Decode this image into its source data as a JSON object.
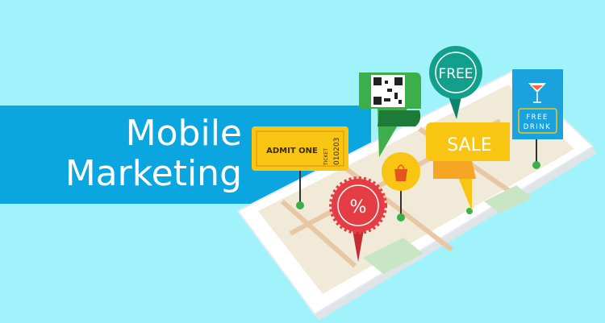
{
  "headline": {
    "line1": "Mobile",
    "line2": "Marketing"
  },
  "tags": {
    "ticket": {
      "main": "ADMIT ONE",
      "side_label": "TICKET",
      "number": "010203"
    },
    "badge_free": "FREE",
    "sale": "SALE",
    "drink": {
      "line1": "FREE",
      "line2": "DRINK"
    },
    "discount": "%"
  },
  "colors": {
    "background": "#a0f3fb",
    "band": "#0ba6df",
    "yellow": "#f9c513",
    "green": "#3daf4a",
    "teal": "#12a08c",
    "red": "#e53d43",
    "blue": "#1aa2df"
  }
}
